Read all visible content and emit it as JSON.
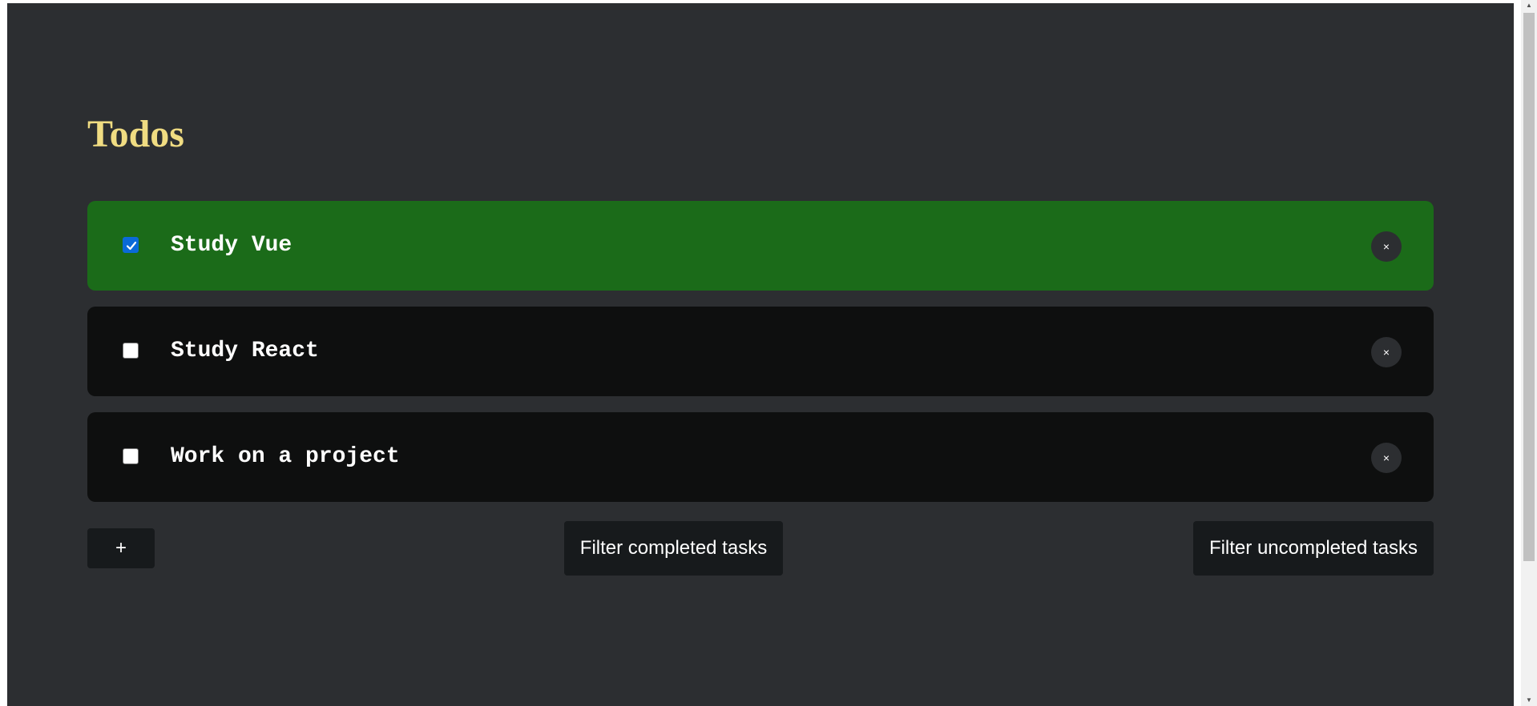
{
  "page": {
    "title": "Todos"
  },
  "todos": [
    {
      "label": "Study Vue",
      "completed": true
    },
    {
      "label": "Study React",
      "completed": false
    },
    {
      "label": "Work on a project",
      "completed": false
    }
  ],
  "actions": {
    "delete_symbol": "×",
    "add_label": "+",
    "filter_completed_label": "Filter completed tasks",
    "filter_uncompleted_label": "Filter uncompleted tasks"
  },
  "scrollbar": {
    "up_arrow": "▲",
    "down_arrow": "▼"
  },
  "colors": {
    "background": "#2c2e31",
    "title": "#f0dc82",
    "completed_item": "#1b6b19",
    "pending_item": "#0e0f0f",
    "button": "#171a1c",
    "checkbox_checked": "#0a6ad8"
  }
}
